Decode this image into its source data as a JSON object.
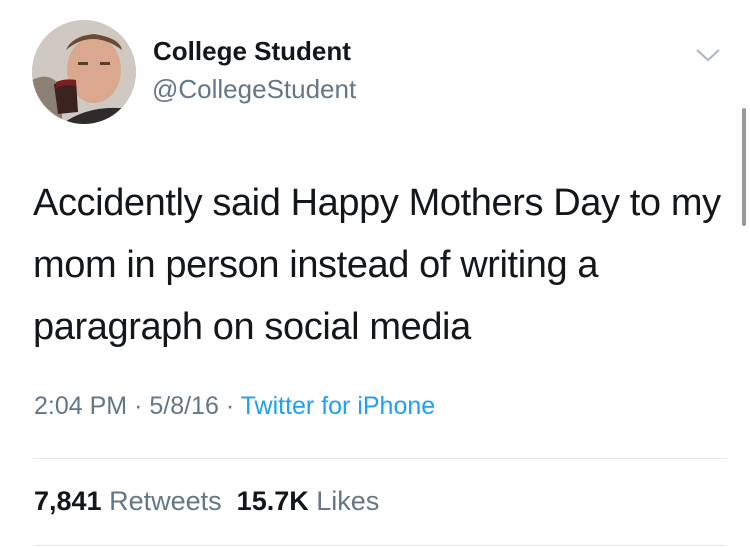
{
  "user": {
    "display_name": "College Student",
    "handle": "@CollegeStudent",
    "avatar_icon": "profile-photo"
  },
  "tweet": {
    "text": "Accidently said Happy Mothers Day to my mom in person instead of writing a paragraph on social media",
    "time": "2:04 PM",
    "date": "5/8/16",
    "separator": "·",
    "source": "Twitter for iPhone"
  },
  "stats": {
    "retweets_count": "7,841",
    "retweets_label": "Retweets",
    "likes_count": "15.7K",
    "likes_label": "Likes"
  },
  "menu_icon": "chevron-down-icon",
  "colors": {
    "text": "#14171a",
    "secondary": "#657786",
    "link": "#1da1f2",
    "divider": "#e1e8ed"
  }
}
